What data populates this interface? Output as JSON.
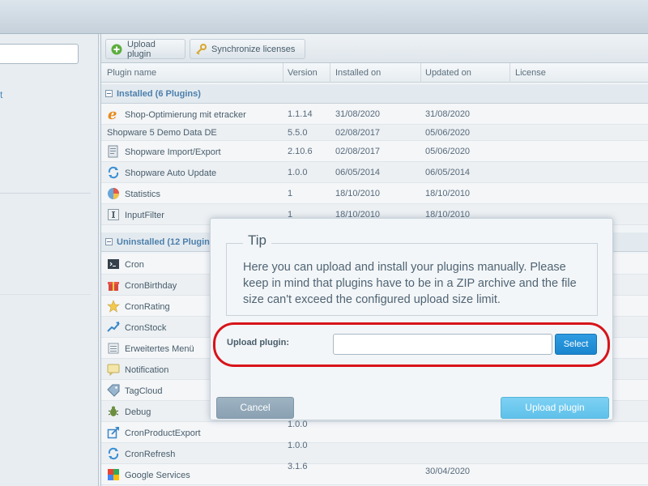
{
  "toolbar": {
    "upload_label": "Upload plugin",
    "sync_label": "Synchronize licenses"
  },
  "columns": {
    "plugin_name": "Plugin name",
    "version": "Version",
    "installed_on": "Installed on",
    "updated_on": "Updated on",
    "license": "License"
  },
  "groups": {
    "installed": "Installed (6 Plugins)",
    "uninstalled": "Uninstalled (12 Plugin"
  },
  "installed_rows": [
    {
      "name": "Shop-Optimierung mit etracker",
      "version": "1.1.14",
      "installed": "31/08/2020",
      "updated": "31/08/2020",
      "icon": "etracker-icon"
    },
    {
      "name": "Shopware 5 Demo Data DE",
      "version": "5.5.0",
      "installed": "02/08/2017",
      "updated": "05/06/2020",
      "icon": ""
    },
    {
      "name": "Shopware Import/Export",
      "version": "2.10.6",
      "installed": "02/08/2017",
      "updated": "05/06/2020",
      "icon": "import-export-icon"
    },
    {
      "name": "Shopware Auto Update",
      "version": "1.0.0",
      "installed": "06/05/2014",
      "updated": "06/05/2014",
      "icon": "auto-update-icon"
    },
    {
      "name": "Statistics",
      "version": "1",
      "installed": "18/10/2010",
      "updated": "18/10/2010",
      "icon": "pie-chart-icon"
    },
    {
      "name": "InputFilter",
      "version": "1",
      "installed": "18/10/2010",
      "updated": "18/10/2010",
      "icon": "input-filter-icon"
    }
  ],
  "uninstalled_rows": [
    {
      "name": "Cron",
      "version": "",
      "installed": "",
      "updated": "",
      "icon": "terminal-icon"
    },
    {
      "name": "CronBirthday",
      "version": "",
      "installed": "",
      "updated": "",
      "icon": "gift-icon"
    },
    {
      "name": "CronRating",
      "version": "",
      "installed": "",
      "updated": "",
      "icon": "star-icon"
    },
    {
      "name": "CronStock",
      "version": "",
      "installed": "",
      "updated": "",
      "icon": "trend-icon"
    },
    {
      "name": "Erweitertes Menü",
      "version": "",
      "installed": "",
      "updated": "",
      "icon": "menu-icon"
    },
    {
      "name": "Notification",
      "version": "",
      "installed": "",
      "updated": "",
      "icon": "notification-icon"
    },
    {
      "name": "TagCloud",
      "version": "",
      "installed": "",
      "updated": "",
      "icon": "tag-icon"
    },
    {
      "name": "Debug",
      "version": "",
      "installed": "",
      "updated": "",
      "icon": "bug-icon"
    },
    {
      "name": "CronProductExport",
      "version": "1.0.0",
      "installed": "",
      "updated": "",
      "icon": "export-icon"
    },
    {
      "name": "CronRefresh",
      "version": "1.0.0",
      "installed": "",
      "updated": "",
      "icon": "refresh-icon"
    },
    {
      "name": "Google Services",
      "version": "3.1.6",
      "installed": "",
      "updated": "30/04/2020",
      "icon": "google-icon"
    }
  ],
  "dialog": {
    "legend": "Tip",
    "tip_text": "Here you can upload and install your plugins manually. Please keep in mind that plugins have to be in a ZIP archive and the file size can't exceed the configured upload size limit.",
    "upload_label": "Upload plugin:",
    "upload_value": "",
    "select_label": "Select",
    "cancel_label": "Cancel",
    "upload_button_label": "Upload plugin"
  },
  "colors": {
    "accent": "#1a86cf",
    "highlight": "#d7141a",
    "group_header_text": "#4c7fac"
  }
}
